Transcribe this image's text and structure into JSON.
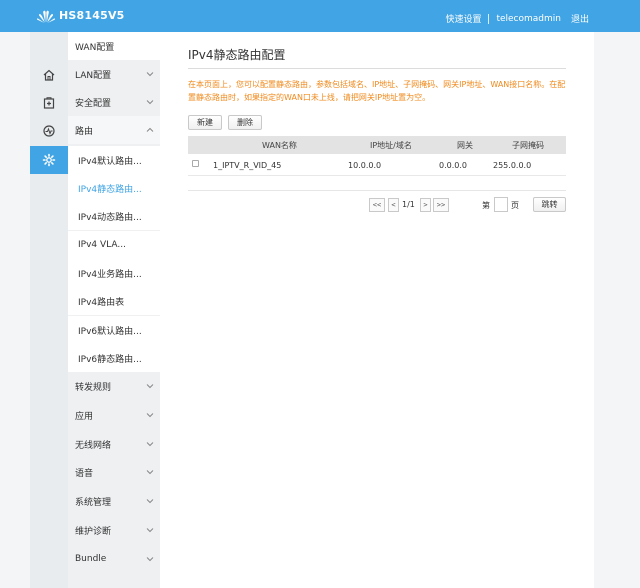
{
  "header": {
    "model": "HS8145V5",
    "links": [
      "快速设置",
      "telecomadmin",
      "退出"
    ]
  },
  "iconbar": {
    "items": [
      {
        "name": "home-icon"
      },
      {
        "name": "status-icon"
      },
      {
        "name": "diagnose-icon"
      },
      {
        "name": "settings-icon",
        "active": true
      }
    ]
  },
  "menu": {
    "top_item": "WAN配置",
    "items_before": [
      "LAN配置",
      "安全配置",
      "路由"
    ],
    "route_submenu": [
      "IPv4默认路由...",
      "IPv4静态路由...",
      "IPv4动态路由...",
      "IPv4 VLA...",
      "IPv4业务路由...",
      "IPv4路由表",
      "IPv6默认路由...",
      "IPv6静态路由..."
    ],
    "active_submenu_index": 1,
    "items_after": [
      "转发规则",
      "应用",
      "无线网络",
      "语音",
      "系统管理",
      "维护诊断",
      "Bundle"
    ]
  },
  "main": {
    "title": "IPv4静态路由配置",
    "description": "在本页面上，您可以配置静态路由，参数包括域名、IP地址、子网掩码、网关IP地址、WAN接口名称。在配置静态路由时，如果指定的WAN口未上线，请把网关IP地址置为空。",
    "buttons": {
      "new": "新建",
      "delete": "删除"
    },
    "table": {
      "headers": [
        "WAN名称",
        "IP地址/域名",
        "网关",
        "子网掩码"
      ],
      "rows": [
        {
          "wan": "1_IPTV_R_VID_45",
          "ip": "10.0.0.0",
          "gateway": "0.0.0.0",
          "mask": "255.0.0.0"
        }
      ]
    },
    "pager": {
      "first": "<<",
      "prev": "<",
      "info": "1/1",
      "next": ">",
      "last": ">>",
      "page_prefix": "第",
      "page_suffix": "页",
      "go": "跳转"
    }
  },
  "colors": {
    "accent": "#41a4e4",
    "warning_text": "#f08a1c"
  }
}
